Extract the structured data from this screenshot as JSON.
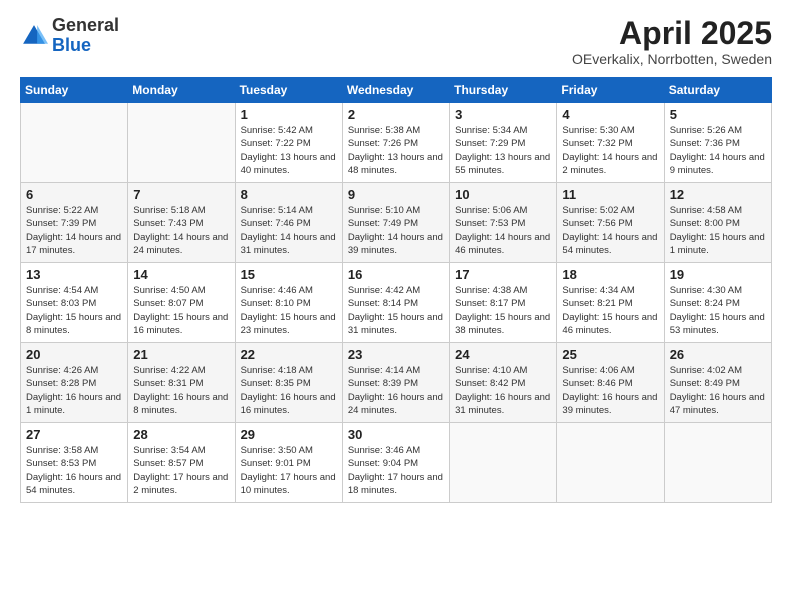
{
  "header": {
    "logo_line1": "General",
    "logo_line2": "Blue",
    "month": "April 2025",
    "location": "OEverkalix, Norrbotten, Sweden"
  },
  "days_of_week": [
    "Sunday",
    "Monday",
    "Tuesday",
    "Wednesday",
    "Thursday",
    "Friday",
    "Saturday"
  ],
  "weeks": [
    [
      {
        "day": "",
        "info": ""
      },
      {
        "day": "",
        "info": ""
      },
      {
        "day": "1",
        "info": "Sunrise: 5:42 AM\nSunset: 7:22 PM\nDaylight: 13 hours and 40 minutes."
      },
      {
        "day": "2",
        "info": "Sunrise: 5:38 AM\nSunset: 7:26 PM\nDaylight: 13 hours and 48 minutes."
      },
      {
        "day": "3",
        "info": "Sunrise: 5:34 AM\nSunset: 7:29 PM\nDaylight: 13 hours and 55 minutes."
      },
      {
        "day": "4",
        "info": "Sunrise: 5:30 AM\nSunset: 7:32 PM\nDaylight: 14 hours and 2 minutes."
      },
      {
        "day": "5",
        "info": "Sunrise: 5:26 AM\nSunset: 7:36 PM\nDaylight: 14 hours and 9 minutes."
      }
    ],
    [
      {
        "day": "6",
        "info": "Sunrise: 5:22 AM\nSunset: 7:39 PM\nDaylight: 14 hours and 17 minutes."
      },
      {
        "day": "7",
        "info": "Sunrise: 5:18 AM\nSunset: 7:43 PM\nDaylight: 14 hours and 24 minutes."
      },
      {
        "day": "8",
        "info": "Sunrise: 5:14 AM\nSunset: 7:46 PM\nDaylight: 14 hours and 31 minutes."
      },
      {
        "day": "9",
        "info": "Sunrise: 5:10 AM\nSunset: 7:49 PM\nDaylight: 14 hours and 39 minutes."
      },
      {
        "day": "10",
        "info": "Sunrise: 5:06 AM\nSunset: 7:53 PM\nDaylight: 14 hours and 46 minutes."
      },
      {
        "day": "11",
        "info": "Sunrise: 5:02 AM\nSunset: 7:56 PM\nDaylight: 14 hours and 54 minutes."
      },
      {
        "day": "12",
        "info": "Sunrise: 4:58 AM\nSunset: 8:00 PM\nDaylight: 15 hours and 1 minute."
      }
    ],
    [
      {
        "day": "13",
        "info": "Sunrise: 4:54 AM\nSunset: 8:03 PM\nDaylight: 15 hours and 8 minutes."
      },
      {
        "day": "14",
        "info": "Sunrise: 4:50 AM\nSunset: 8:07 PM\nDaylight: 15 hours and 16 minutes."
      },
      {
        "day": "15",
        "info": "Sunrise: 4:46 AM\nSunset: 8:10 PM\nDaylight: 15 hours and 23 minutes."
      },
      {
        "day": "16",
        "info": "Sunrise: 4:42 AM\nSunset: 8:14 PM\nDaylight: 15 hours and 31 minutes."
      },
      {
        "day": "17",
        "info": "Sunrise: 4:38 AM\nSunset: 8:17 PM\nDaylight: 15 hours and 38 minutes."
      },
      {
        "day": "18",
        "info": "Sunrise: 4:34 AM\nSunset: 8:21 PM\nDaylight: 15 hours and 46 minutes."
      },
      {
        "day": "19",
        "info": "Sunrise: 4:30 AM\nSunset: 8:24 PM\nDaylight: 15 hours and 53 minutes."
      }
    ],
    [
      {
        "day": "20",
        "info": "Sunrise: 4:26 AM\nSunset: 8:28 PM\nDaylight: 16 hours and 1 minute."
      },
      {
        "day": "21",
        "info": "Sunrise: 4:22 AM\nSunset: 8:31 PM\nDaylight: 16 hours and 8 minutes."
      },
      {
        "day": "22",
        "info": "Sunrise: 4:18 AM\nSunset: 8:35 PM\nDaylight: 16 hours and 16 minutes."
      },
      {
        "day": "23",
        "info": "Sunrise: 4:14 AM\nSunset: 8:39 PM\nDaylight: 16 hours and 24 minutes."
      },
      {
        "day": "24",
        "info": "Sunrise: 4:10 AM\nSunset: 8:42 PM\nDaylight: 16 hours and 31 minutes."
      },
      {
        "day": "25",
        "info": "Sunrise: 4:06 AM\nSunset: 8:46 PM\nDaylight: 16 hours and 39 minutes."
      },
      {
        "day": "26",
        "info": "Sunrise: 4:02 AM\nSunset: 8:49 PM\nDaylight: 16 hours and 47 minutes."
      }
    ],
    [
      {
        "day": "27",
        "info": "Sunrise: 3:58 AM\nSunset: 8:53 PM\nDaylight: 16 hours and 54 minutes."
      },
      {
        "day": "28",
        "info": "Sunrise: 3:54 AM\nSunset: 8:57 PM\nDaylight: 17 hours and 2 minutes."
      },
      {
        "day": "29",
        "info": "Sunrise: 3:50 AM\nSunset: 9:01 PM\nDaylight: 17 hours and 10 minutes."
      },
      {
        "day": "30",
        "info": "Sunrise: 3:46 AM\nSunset: 9:04 PM\nDaylight: 17 hours and 18 minutes."
      },
      {
        "day": "",
        "info": ""
      },
      {
        "day": "",
        "info": ""
      },
      {
        "day": "",
        "info": ""
      }
    ]
  ]
}
